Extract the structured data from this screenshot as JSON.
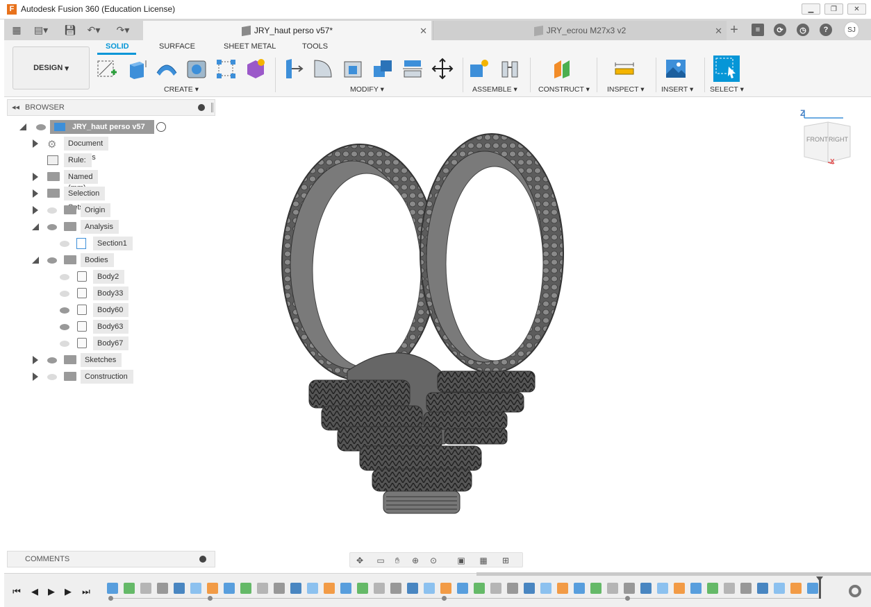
{
  "window": {
    "title": "Autodesk Fusion 360 (Education License)",
    "logo_letter": "F"
  },
  "tabs": {
    "active": "JRY_haut perso v57*",
    "inactive": "JRY_ecrou M27x3 v2",
    "user_initials": "SJ"
  },
  "toolbar": {
    "workspace": "DESIGN",
    "workspace_caret": "▾",
    "ribbon_tabs": [
      "SOLID",
      "SURFACE",
      "SHEET METAL",
      "TOOLS"
    ],
    "groups": [
      "CREATE",
      "MODIFY",
      "ASSEMBLE",
      "CONSTRUCT",
      "INSPECT",
      "INSERT",
      "SELECT"
    ],
    "caret": "▾"
  },
  "browser": {
    "header": "BROWSER",
    "root": "JRY_haut perso v57",
    "items": [
      {
        "label": "Document Settings"
      },
      {
        "label": "Rule: Steel (mm)"
      },
      {
        "label": "Named Views"
      },
      {
        "label": "Selection Sets"
      },
      {
        "label": "Origin"
      },
      {
        "label": "Analysis"
      },
      {
        "label": "Section1"
      },
      {
        "label": "Bodies"
      },
      {
        "label": "Body2"
      },
      {
        "label": "Body33"
      },
      {
        "label": "Body60"
      },
      {
        "label": "Body63"
      },
      {
        "label": "Body67"
      },
      {
        "label": "Sketches"
      },
      {
        "label": "Construction"
      }
    ]
  },
  "viewcube": {
    "z": "Z",
    "front": "FRONT",
    "right": "RIGHT",
    "x": "X"
  },
  "comments": {
    "header": "COMMENTS"
  },
  "colors": {
    "accent": "#0696d7",
    "model": "#6e6e6e"
  }
}
